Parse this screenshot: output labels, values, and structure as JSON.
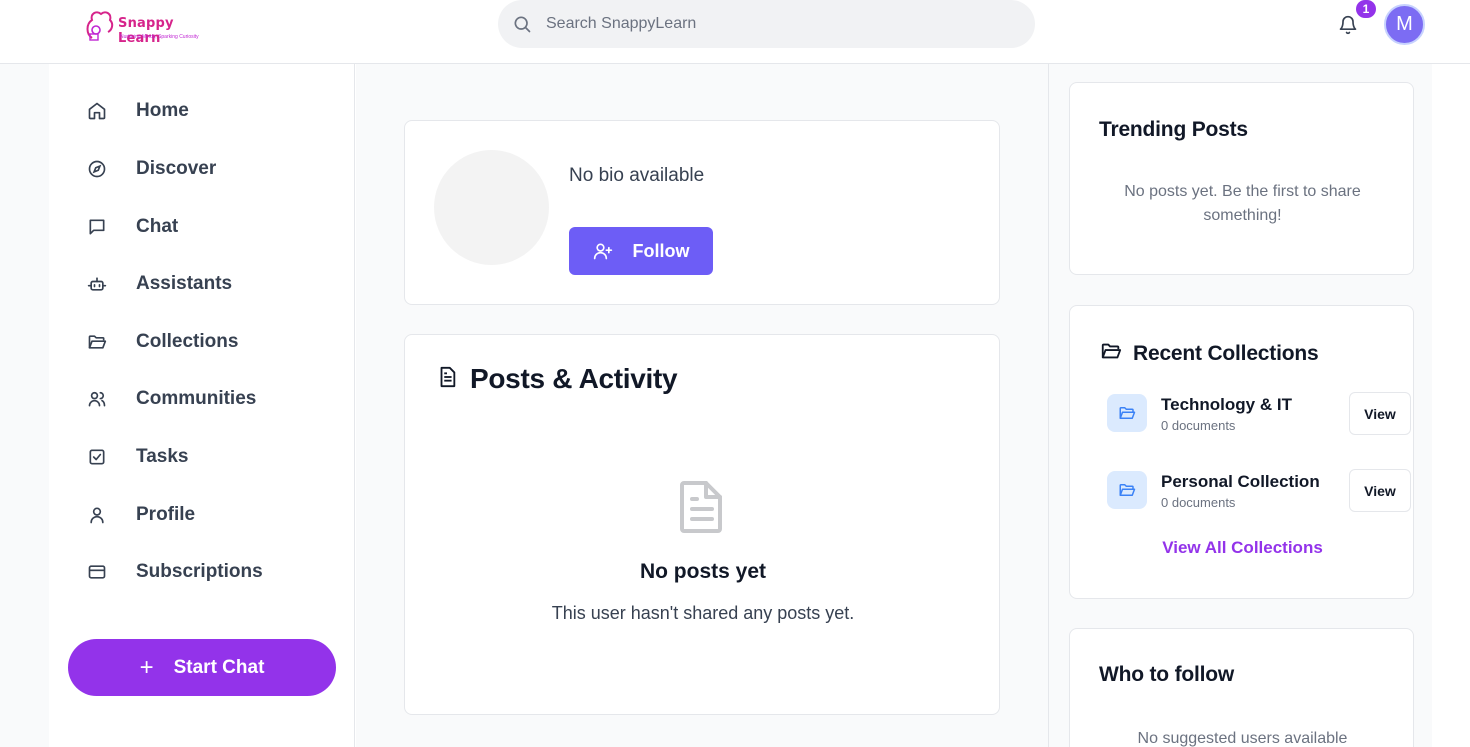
{
  "header": {
    "logo_name": "Snappy Learn",
    "logo_tagline": "Nurturing Minds, Sparking Curiosity",
    "search_placeholder": "Search SnappyLearn",
    "notification_count": "1",
    "avatar_initial": "M",
    "brand_color": "#9333ea"
  },
  "sidebar": {
    "items": [
      {
        "label": "Home",
        "icon": "home-icon"
      },
      {
        "label": "Discover",
        "icon": "compass-icon"
      },
      {
        "label": "Chat",
        "icon": "message-icon"
      },
      {
        "label": "Assistants",
        "icon": "bot-icon"
      },
      {
        "label": "Collections",
        "icon": "folder-open-icon"
      },
      {
        "label": "Communities",
        "icon": "users-icon"
      },
      {
        "label": "Tasks",
        "icon": "check-square-icon"
      },
      {
        "label": "Profile",
        "icon": "user-icon"
      },
      {
        "label": "Subscriptions",
        "icon": "credit-card-icon"
      }
    ],
    "start_chat_label": "Start Chat"
  },
  "profile": {
    "bio": "No bio available",
    "follow_label": "Follow"
  },
  "posts": {
    "title": "Posts & Activity",
    "empty_title": "No posts yet",
    "empty_subtitle": "This user hasn't shared any posts yet."
  },
  "trending": {
    "title": "Trending Posts",
    "empty_text": "No posts yet. Be the first to share something!"
  },
  "recent_collections": {
    "title": "Recent Collections",
    "items": [
      {
        "name": "Technology & IT",
        "count": "0 documents",
        "view_label": "View"
      },
      {
        "name": "Personal Collection",
        "count": "0 documents",
        "view_label": "View"
      }
    ],
    "view_all_label": "View All Collections"
  },
  "who_to_follow": {
    "title": "Who to follow",
    "empty_text": "No suggested users available"
  }
}
